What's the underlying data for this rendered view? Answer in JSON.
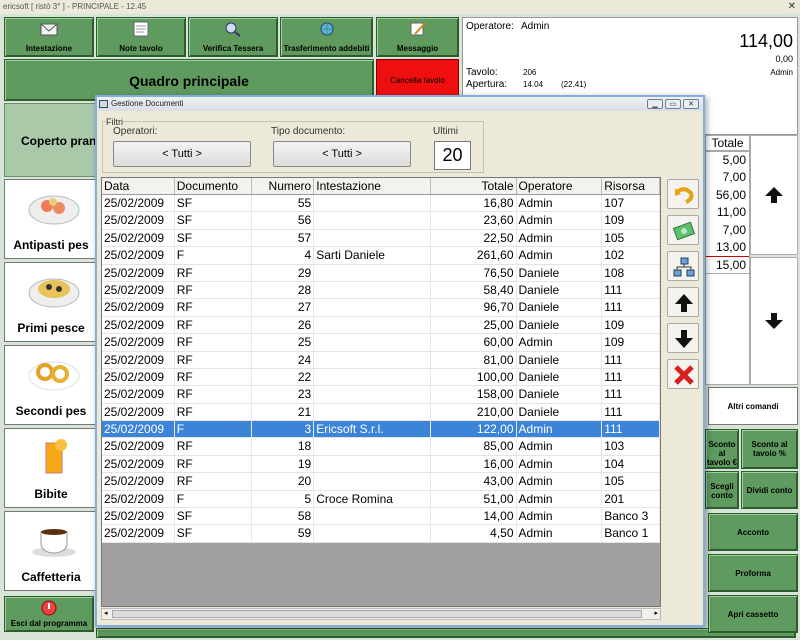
{
  "app": {
    "title": "ericsoft [ ristò 3° ] - PRINCIPALE - 12.45",
    "close_glyph": "✕"
  },
  "toolbar": {
    "intestazione": "Intestazione",
    "note_tavolo": "Note tavolo",
    "verifica_tessera": "Verifica Tessera",
    "trasferimento_addebiti": "Trasferimento addebiti",
    "messaggio": "Messaggio"
  },
  "main": {
    "quadro_principale": "Quadro principale",
    "cancella_tavolo": "Cancella tavolo",
    "coperto": "Coperto pran"
  },
  "categories": [
    {
      "label": "Antipasti pes"
    },
    {
      "label": "Primi pesce"
    },
    {
      "label": "Secondi pes"
    },
    {
      "label": "Bibite"
    },
    {
      "label": "Caffetteria"
    }
  ],
  "exit_button": "Esci dal programma",
  "right_panel": {
    "operatore_label": "Operatore:",
    "operatore_value": "Admin",
    "total": "114,00",
    "subtotal": "0,00",
    "user": "Admin",
    "tavolo_label": "Tavolo:",
    "tavolo_value": "206",
    "apertura_label": "Apertura:",
    "apertura_value": "14.04",
    "apertura_time": "(22.41)",
    "totale_header": "Totale",
    "amounts": [
      "5,00",
      "7,00",
      "56,00",
      "11,00",
      "7,00",
      "13,00",
      "15,00"
    ]
  },
  "right_buttons": {
    "altri_comandi": "Altri comandi",
    "sconto_tavolo_euro": "Sconto al tavolo €",
    "sconto_tavolo_pct": "Sconto al tavolo %",
    "scegli_conto": "Scegli conto",
    "dividi_conto": "Dividi conto",
    "acconto": "Acconto",
    "proforma": "Proforma",
    "apri_cassetto": "Apri cassetto"
  },
  "dialog": {
    "title": "Gestione Documenti",
    "filters_title": "Filtri",
    "operatori_label": "Operatori:",
    "operatori_value": "< Tutti >",
    "tipo_label": "Tipo documento:",
    "tipo_value": "< Tutti >",
    "ultimi_label": "Ultimi",
    "ultimi_value": "20",
    "columns": [
      "Data",
      "Documento",
      "Numero",
      "Intestazione",
      "Totale",
      "Operatore",
      "Risorsa"
    ],
    "rows": [
      {
        "data": "25/02/2009",
        "doc": "SF",
        "num": "55",
        "int": "",
        "tot": "16,80",
        "op": "Admin",
        "ris": "107"
      },
      {
        "data": "25/02/2009",
        "doc": "SF",
        "num": "56",
        "int": "",
        "tot": "23,60",
        "op": "Admin",
        "ris": "109"
      },
      {
        "data": "25/02/2009",
        "doc": "SF",
        "num": "57",
        "int": "",
        "tot": "22,50",
        "op": "Admin",
        "ris": "105"
      },
      {
        "data": "25/02/2009",
        "doc": "F",
        "num": "4",
        "int": "Sarti Daniele",
        "tot": "261,60",
        "op": "Admin",
        "ris": "102"
      },
      {
        "data": "25/02/2009",
        "doc": "RF",
        "num": "29",
        "int": "",
        "tot": "76,50",
        "op": "Daniele",
        "ris": "108"
      },
      {
        "data": "25/02/2009",
        "doc": "RF",
        "num": "28",
        "int": "",
        "tot": "58,40",
        "op": "Daniele",
        "ris": "111"
      },
      {
        "data": "25/02/2009",
        "doc": "RF",
        "num": "27",
        "int": "",
        "tot": "96,70",
        "op": "Daniele",
        "ris": "111"
      },
      {
        "data": "25/02/2009",
        "doc": "RF",
        "num": "26",
        "int": "",
        "tot": "25,00",
        "op": "Daniele",
        "ris": "109"
      },
      {
        "data": "25/02/2009",
        "doc": "RF",
        "num": "25",
        "int": "",
        "tot": "60,00",
        "op": "Admin",
        "ris": "109"
      },
      {
        "data": "25/02/2009",
        "doc": "RF",
        "num": "24",
        "int": "",
        "tot": "81,00",
        "op": "Daniele",
        "ris": "111"
      },
      {
        "data": "25/02/2009",
        "doc": "RF",
        "num": "22",
        "int": "",
        "tot": "100,00",
        "op": "Daniele",
        "ris": "111"
      },
      {
        "data": "25/02/2009",
        "doc": "RF",
        "num": "23",
        "int": "",
        "tot": "158,00",
        "op": "Daniele",
        "ris": "111"
      },
      {
        "data": "25/02/2009",
        "doc": "RF",
        "num": "21",
        "int": "",
        "tot": "210,00",
        "op": "Daniele",
        "ris": "111"
      },
      {
        "data": "25/02/2009",
        "doc": "F",
        "num": "3",
        "int": "Ericsoft S.r.l.",
        "tot": "122,00",
        "op": "Admin",
        "ris": "111",
        "selected": true
      },
      {
        "data": "25/02/2009",
        "doc": "RF",
        "num": "18",
        "int": "",
        "tot": "85,00",
        "op": "Admin",
        "ris": "103"
      },
      {
        "data": "25/02/2009",
        "doc": "RF",
        "num": "19",
        "int": "",
        "tot": "16,00",
        "op": "Admin",
        "ris": "104"
      },
      {
        "data": "25/02/2009",
        "doc": "RF",
        "num": "20",
        "int": "",
        "tot": "43,00",
        "op": "Admin",
        "ris": "105"
      },
      {
        "data": "25/02/2009",
        "doc": "F",
        "num": "5",
        "int": "Croce Romina",
        "tot": "51,00",
        "op": "Admin",
        "ris": "201"
      },
      {
        "data": "25/02/2009",
        "doc": "SF",
        "num": "58",
        "int": "",
        "tot": "14,00",
        "op": "Admin",
        "ris": "Banco 3"
      },
      {
        "data": "25/02/2009",
        "doc": "SF",
        "num": "59",
        "int": "",
        "tot": "4,50",
        "op": "Admin",
        "ris": "Banco 1"
      }
    ],
    "side_icons": [
      "undo-arrow-icon",
      "banknote-icon",
      "network-icon",
      "arrow-up-icon",
      "arrow-down-icon",
      "delete-x-icon"
    ]
  }
}
